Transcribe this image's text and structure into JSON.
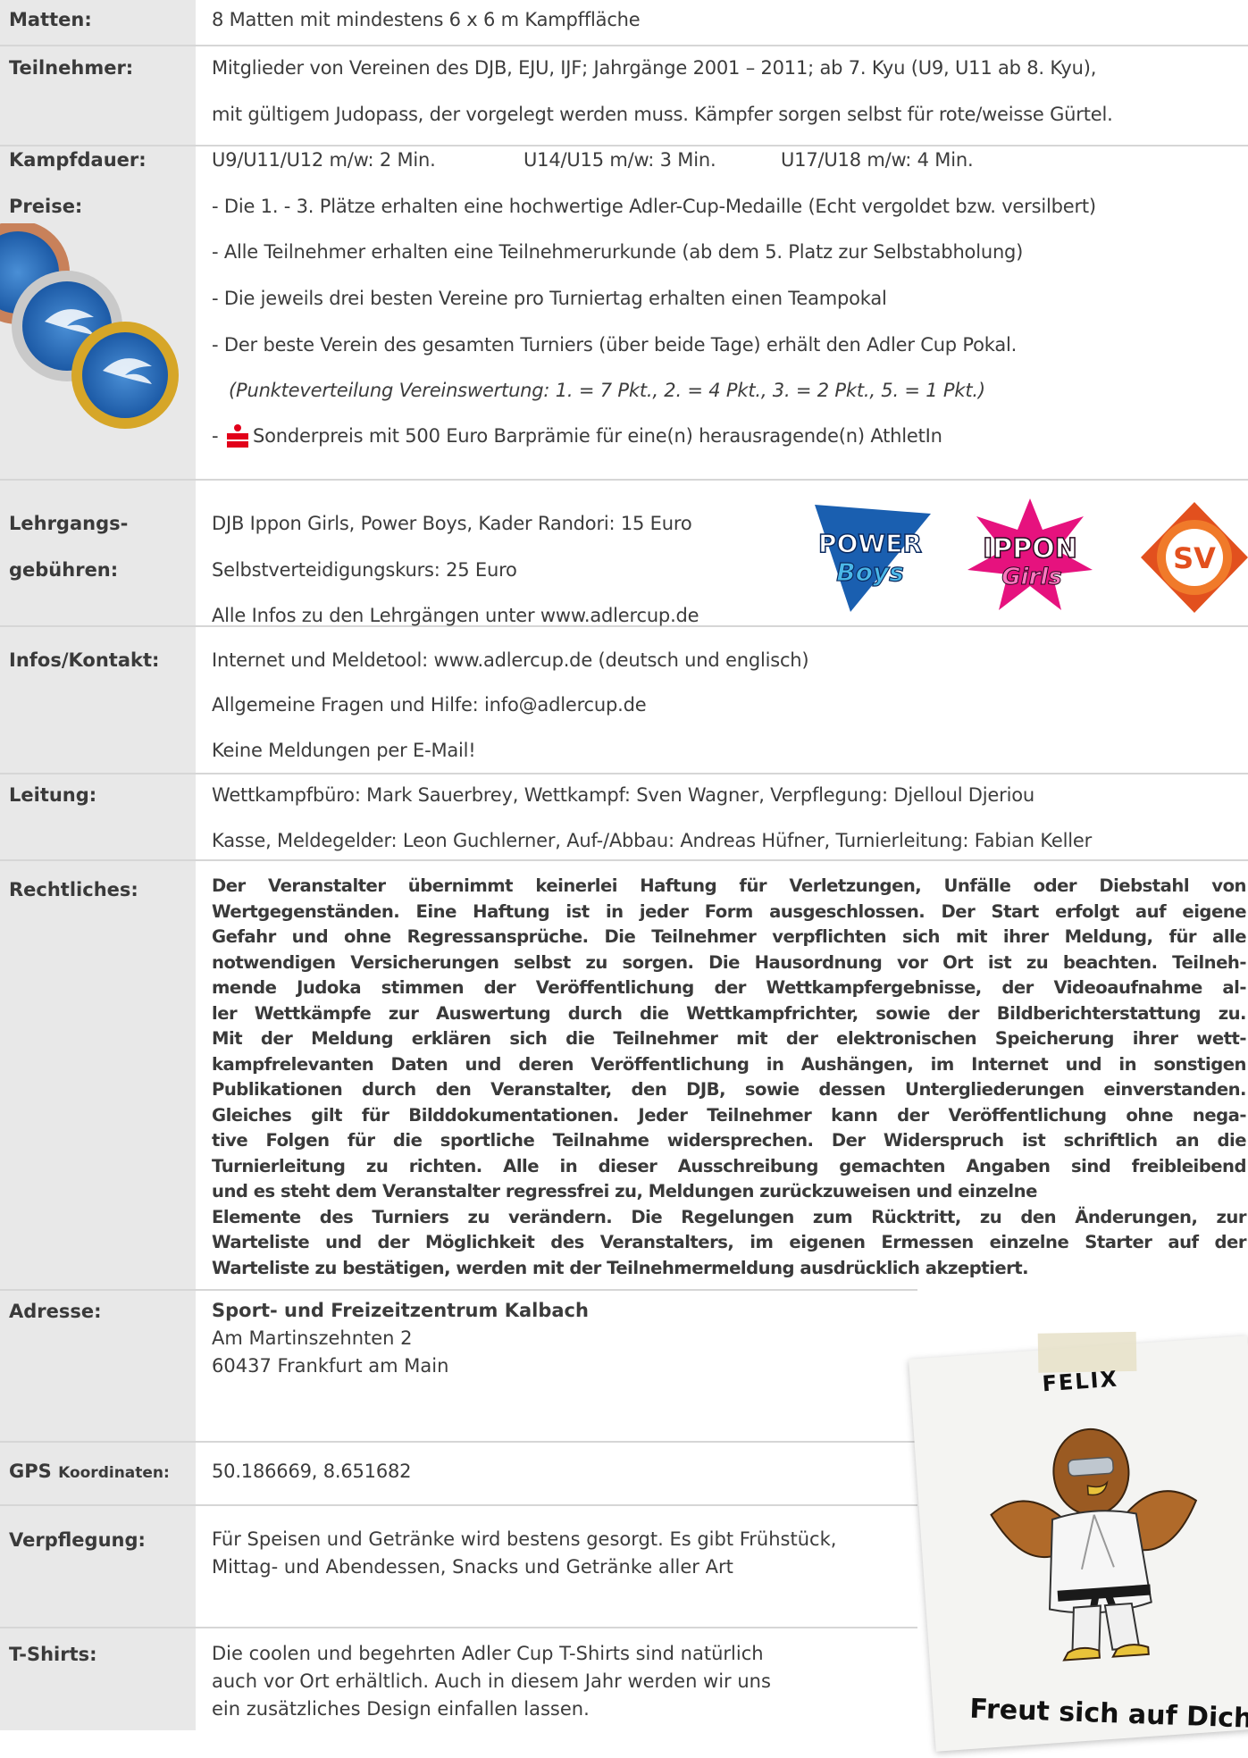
{
  "rows": {
    "matten": {
      "label": "Matten:",
      "lines": [
        "8 Matten mit mindestens 6 x 6 m Kampffläche"
      ]
    },
    "teilnehmer": {
      "label": "Teilnehmer:",
      "lines": [
        "Mitglieder von Vereinen des DJB, EJU, IJF; Jahrgänge 2001 – 2011; ab 7. Kyu (U9, U11 ab 8. Kyu),",
        "mit gültigem Judopass, der vorgelegt werden muss. Kämpfer sorgen selbst für rote/weisse Gürtel."
      ]
    },
    "kampfdauer": {
      "label": "Kampfdauer:",
      "items": [
        "U9/U11/U12 m/w: 2 Min.",
        "U14/U15 m/w: 3 Min.",
        "U17/U18 m/w: 4 Min."
      ]
    },
    "preise": {
      "label": "Preise:",
      "lines": [
        "- Die 1. - 3. Plätze erhalten eine hochwertige Adler-Cup-Medaille (Echt vergoldet bzw. versilbert)",
        "- Alle Teilnehmer erhalten eine Teilnehmerurkunde (ab dem 5. Platz zur Selbstabholung)",
        "- Die jeweils drei besten Vereine pro Turniertag erhalten einen Teampokal",
        "- Der beste Verein des gesamten Turniers (über beide Tage) erhält den Adler Cup Pokal.",
        "(Punkteverteilung Vereinswertung: 1. = 7 Pkt., 2. = 4 Pkt.,  3. = 2 Pkt., 5. = 1 Pkt.)"
      ],
      "special_prefix": "-",
      "special": "Sonderpreis mit 500 Euro Barprämie für eine(n) herausragende(n) AthletIn"
    },
    "lehrgang": {
      "label_1": "Lehrgangs-",
      "label_2": "gebühren:",
      "lines": [
        "DJB Ippon Girls, Power Boys, Kader Randori: 15 Euro",
        "Selbstverteidigungskurs: 25 Euro",
        "Alle Infos zu den Lehrgängen unter www.adlercup.de"
      ],
      "logos": {
        "power_1": "POWER",
        "power_2": "Boys",
        "ippon_1": "IPPON",
        "ippon_2": "Girls",
        "sv": "SV"
      }
    },
    "infos": {
      "label": "Infos/Kontakt:",
      "lines": [
        "Internet und Meldetool: www.adlercup.de (deutsch und englisch)",
        "Allgemeine Fragen und Hilfe: info@adlercup.de",
        "Keine Meldungen per E-Mail!"
      ]
    },
    "leitung": {
      "label": "Leitung:",
      "lines": [
        "Wettkampfbüro: Mark Sauerbrey, Wettkampf: Sven Wagner, Verpflegung: Djelloul Djeriou",
        "Kasse, Meldegelder: Leon Guchlerner, Auf-/Abbau: Andreas Hüfner, Turnierleitung: Fabian Keller"
      ]
    },
    "rechtliches": {
      "label": "Rechtliches:",
      "lines": [
        "Der Veranstalter übernimmt keinerlei Haftung für Verletzungen, Unfälle oder Diebstahl von",
        "Wertgegenständen. Eine Haftung ist in jeder Form ausgeschlossen. Der Start erfolgt auf eigene",
        "Gefahr und ohne Regressansprüche. Die Teilnehmer verpflichten sich mit ihrer Meldung, für alle",
        "notwendigen Versicherungen selbst zu sorgen. Die Hausordnung vor Ort ist zu beachten. Teilneh-",
        "mende Judoka stimmen der Veröffentlichung der Wettkampfergebnisse, der Videoaufnahme al-",
        "ler Wettkämpfe zur Auswertung durch die Wettkampfrichter, sowie der Bildberichterstattung zu.",
        "Mit der Meldung erklären sich die Teilnehmer mit der elektronischen Speicherung ihrer wett-",
        "kampfrelevanten Daten und deren Veröffentlichung in Aushängen, im Internet und in sonstigen",
        "Publikationen durch den Veranstalter, den DJB, sowie dessen Untergliederungen einverstanden.",
        "Gleiches gilt für Bilddokumentationen. Jeder Teilnehmer kann der Veröffentlichung ohne nega-",
        "tive Folgen für die sportliche Teilnahme widersprechen. Der Widerspruch ist schriftlich an die",
        "Turnierleitung zu richten. Alle in dieser Ausschreibung gemachten Angaben sind freibleibend",
        "und es steht dem Veranstalter regressfrei zu, Meldungen zurückzuweisen und einzelne",
        "Elemente des Turniers zu verändern. Die Regelungen zum Rücktritt, zu den Änderungen, zur",
        "Warteliste und der Möglichkeit des Veranstalters, im eigenen Ermessen einzelne Starter auf der",
        "Warteliste zu bestätigen, werden mit der Teilnehmermeldung ausdrücklich akzeptiert."
      ]
    },
    "adresse": {
      "label": "Adresse:",
      "name": "Sport- und Freizeitzentrum Kalbach",
      "street": "Am Martinszehnten 2",
      "city": "60437 Frankfurt am Main"
    },
    "gps": {
      "label_main": "GPS",
      "label_small": "Koordinaten:",
      "value": "50.186669, 8.651682"
    },
    "verpflegung": {
      "label": "Verpflegung:",
      "lines": [
        "Für Speisen und Getränke wird bestens gesorgt. Es gibt Frühstück,",
        "Mittag- und Abendessen, Snacks und Getränke aller Art"
      ]
    },
    "tshirts": {
      "label": "T-Shirts:",
      "lines": [
        "Die coolen und begehrten Adler Cup T-Shirts sind natürlich",
        "auch vor Ort erhältlich. Auch in diesem Jahr werden wir uns",
        "ein zusätzliches Design einfallen lassen."
      ]
    }
  },
  "felix": {
    "name": "FELIX",
    "caption": "Freut sich auf Dich!"
  },
  "colors": {
    "leftcol": "#e8e8e8",
    "divider": "#d6d6d6",
    "sparkasse": "#e2001a",
    "sv": "#e2501e"
  }
}
